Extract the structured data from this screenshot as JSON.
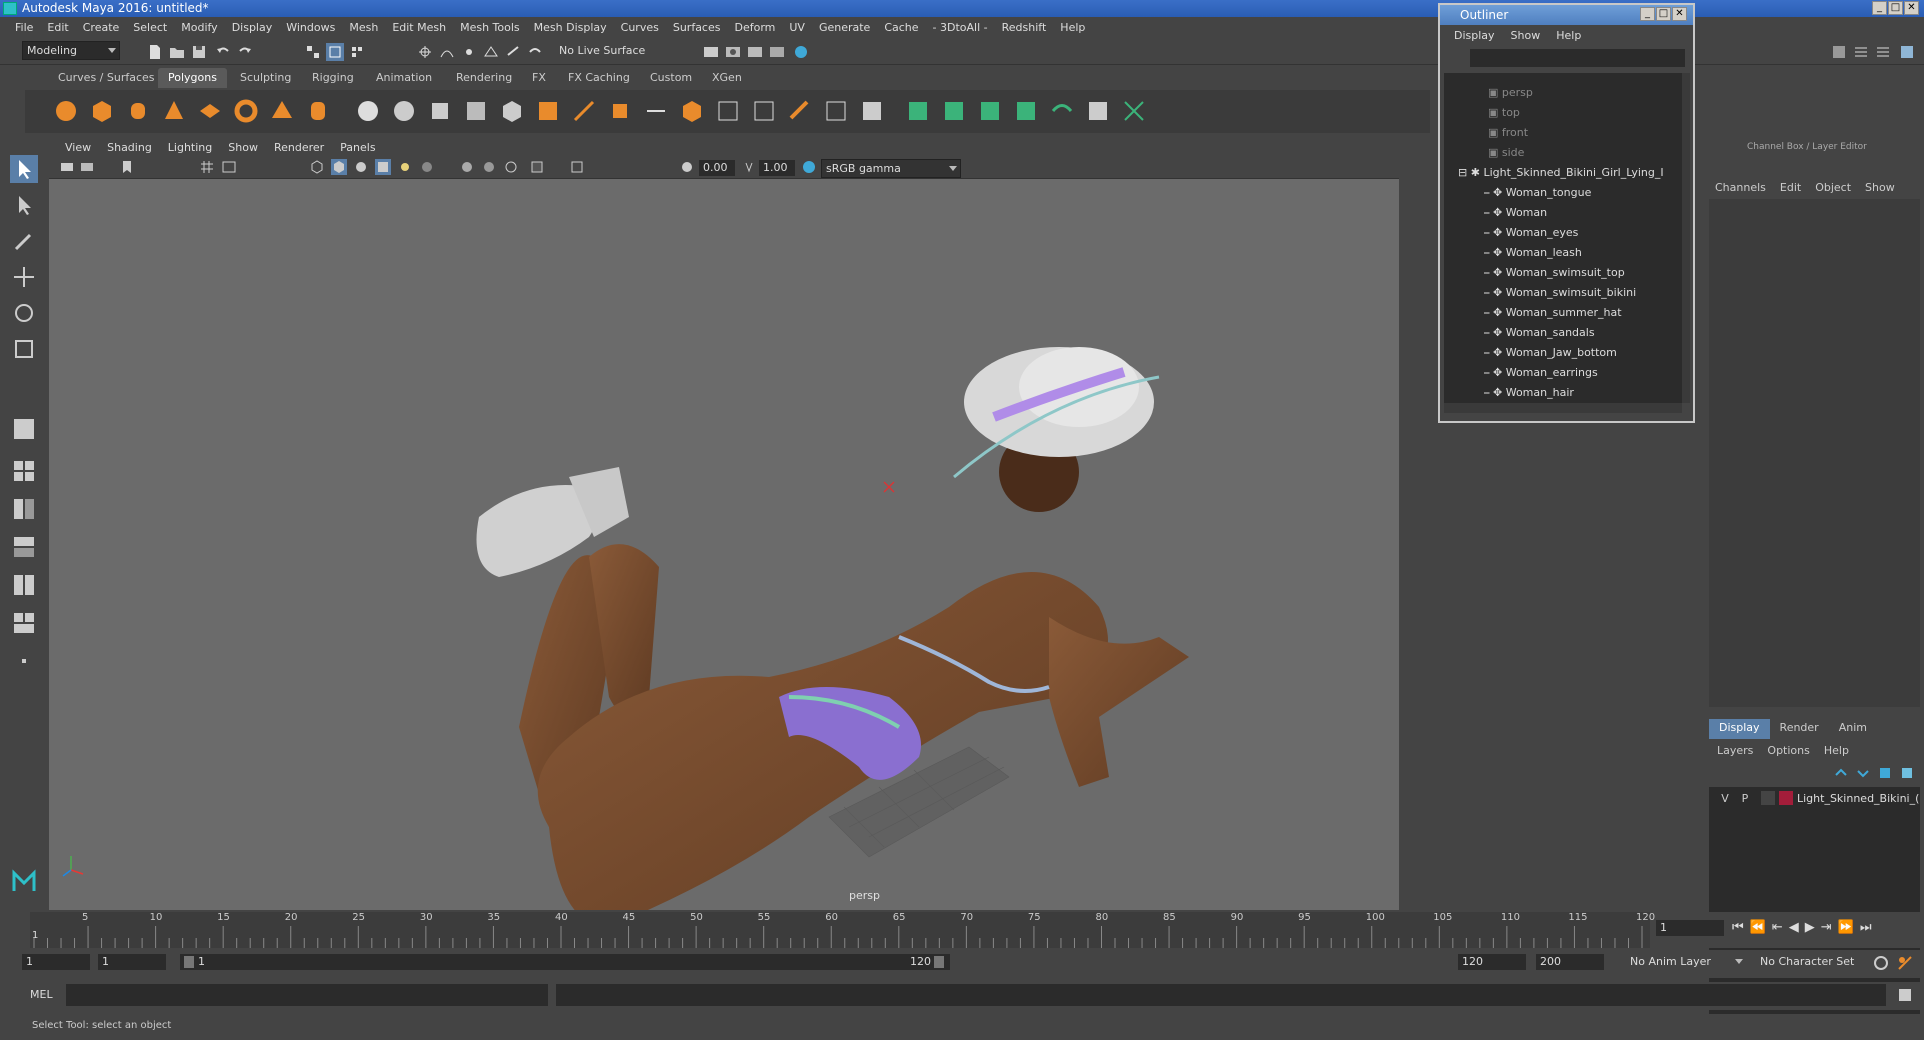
{
  "window": {
    "title": "Autodesk Maya 2016: untitled*"
  },
  "menubar": [
    "File",
    "Edit",
    "Create",
    "Select",
    "Modify",
    "Display",
    "Windows",
    "Mesh",
    "Edit Mesh",
    "Mesh Tools",
    "Mesh Display",
    "Curves",
    "Surfaces",
    "Deform",
    "UV",
    "Generate",
    "Cache",
    "- 3DtoAll -",
    "Redshift",
    "Help"
  ],
  "status": {
    "mode": "Modeling",
    "live_surface": "No Live Surface"
  },
  "shelf_tabs": [
    "Curves / Surfaces",
    "Polygons",
    "Sculpting",
    "Rigging",
    "Animation",
    "Rendering",
    "FX",
    "FX Caching",
    "Custom",
    "XGen"
  ],
  "shelf_active": "Polygons",
  "viewport": {
    "menu": [
      "View",
      "Shading",
      "Lighting",
      "Show",
      "Renderer",
      "Panels"
    ],
    "exposure": "0.00",
    "gamma": "1.00",
    "color_space": "sRGB gamma",
    "camera_label": "persp"
  },
  "outliner": {
    "title": "Outliner",
    "menu": [
      "Display",
      "Show",
      "Help"
    ],
    "cameras": [
      "persp",
      "top",
      "front",
      "side"
    ],
    "group": "Light_Skinned_Bikini_Girl_Lying_I",
    "children": [
      "Woman_tongue",
      "Woman",
      "Woman_eyes",
      "Woman_leash",
      "Woman_swimsuit_top",
      "Woman_swimsuit_bikini",
      "Woman_summer_hat",
      "Woman_sandals",
      "Woman_Jaw_bottom",
      "Woman_earrings",
      "Woman_hair"
    ]
  },
  "channel_box": {
    "title": "Channel Box / Layer Editor",
    "menu": [
      "Channels",
      "Edit",
      "Object",
      "Show"
    ],
    "tabs": [
      "Display",
      "Render",
      "Anim"
    ],
    "layer_menu": [
      "Layers",
      "Options",
      "Help"
    ],
    "layer": {
      "v": "V",
      "p": "P",
      "name": "Light_Skinned_Bikini_("
    }
  },
  "timeline": {
    "ticks": [
      "5",
      "10",
      "15",
      "20",
      "25",
      "30",
      "35",
      "40",
      "45",
      "50",
      "55",
      "60",
      "65",
      "70",
      "75",
      "80",
      "85",
      "90",
      "95",
      "100",
      "105",
      "110",
      "115",
      "120"
    ],
    "start_tick": "1",
    "current_frame": "1"
  },
  "range": {
    "start": "1",
    "playback_start": "1",
    "slider_start": "1",
    "slider_end": "120",
    "playback_end": "120",
    "end": "200",
    "anim_layer": "No Anim Layer",
    "character_set": "No Character Set"
  },
  "mel": {
    "label": "MEL"
  },
  "help": {
    "text": "Select Tool: select an object"
  }
}
